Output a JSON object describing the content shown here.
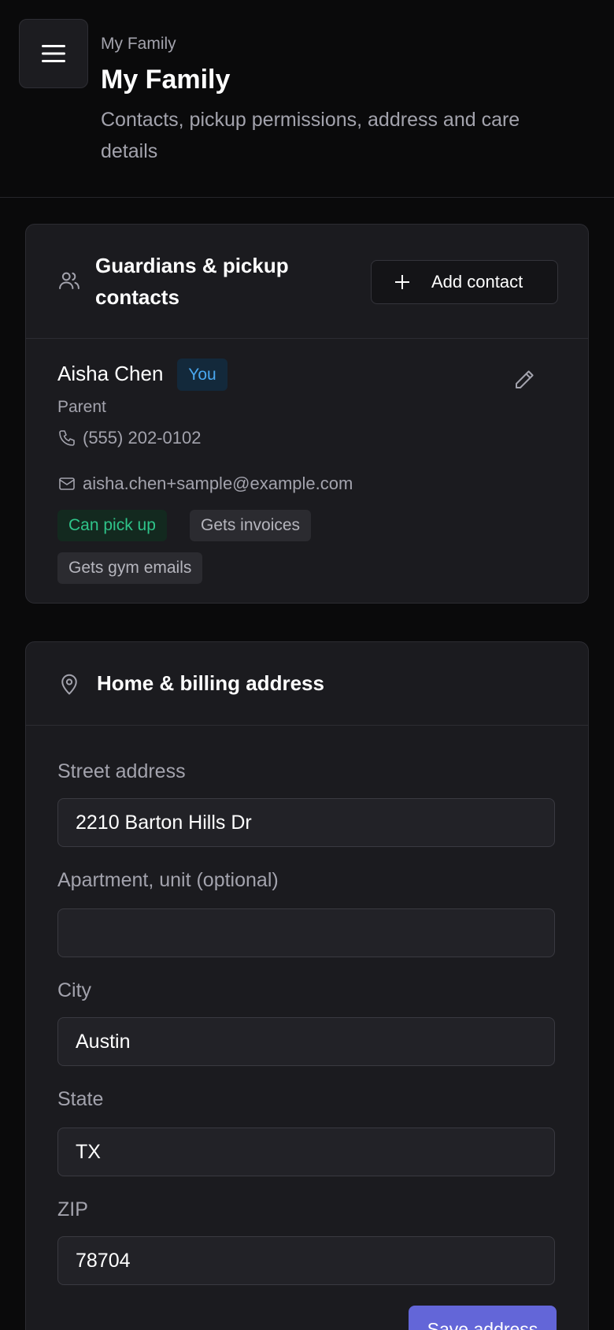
{
  "header": {
    "breadcrumb": "My Family",
    "title": "My Family",
    "subtitle": "Contacts, pickup permissions, address and care details",
    "menu_icon": "hamburger-menu-icon"
  },
  "guardians": {
    "title": "Guardians & pickup contacts",
    "icon": "users-icon",
    "add_button_label": "Add contact",
    "contacts": [
      {
        "name": "Aisha Chen",
        "badge": "You",
        "role": "Parent",
        "phone": "(555) 202-0102",
        "email": "aisha.chen+sample@example.com",
        "tags": [
          "Can pick up",
          "Gets invoices",
          "Gets gym emails"
        ]
      }
    ]
  },
  "address": {
    "title": "Home & billing address",
    "icon": "map-pin-icon",
    "fields": {
      "street": {
        "label": "Street address",
        "value": "2210 Barton Hills Dr"
      },
      "unit": {
        "label": "Apartment, unit (optional)",
        "value": ""
      },
      "city": {
        "label": "City",
        "value": "Austin"
      },
      "state": {
        "label": "State",
        "value": "TX"
      },
      "zip": {
        "label": "ZIP",
        "value": "78704"
      }
    },
    "save_label": "Save address"
  },
  "colors": {
    "background": "#0a0a0b",
    "card": "#1b1b1f",
    "accent": "#6366d8",
    "badge_blue": "#4aa8f0",
    "tag_green": "#2fc48a"
  }
}
